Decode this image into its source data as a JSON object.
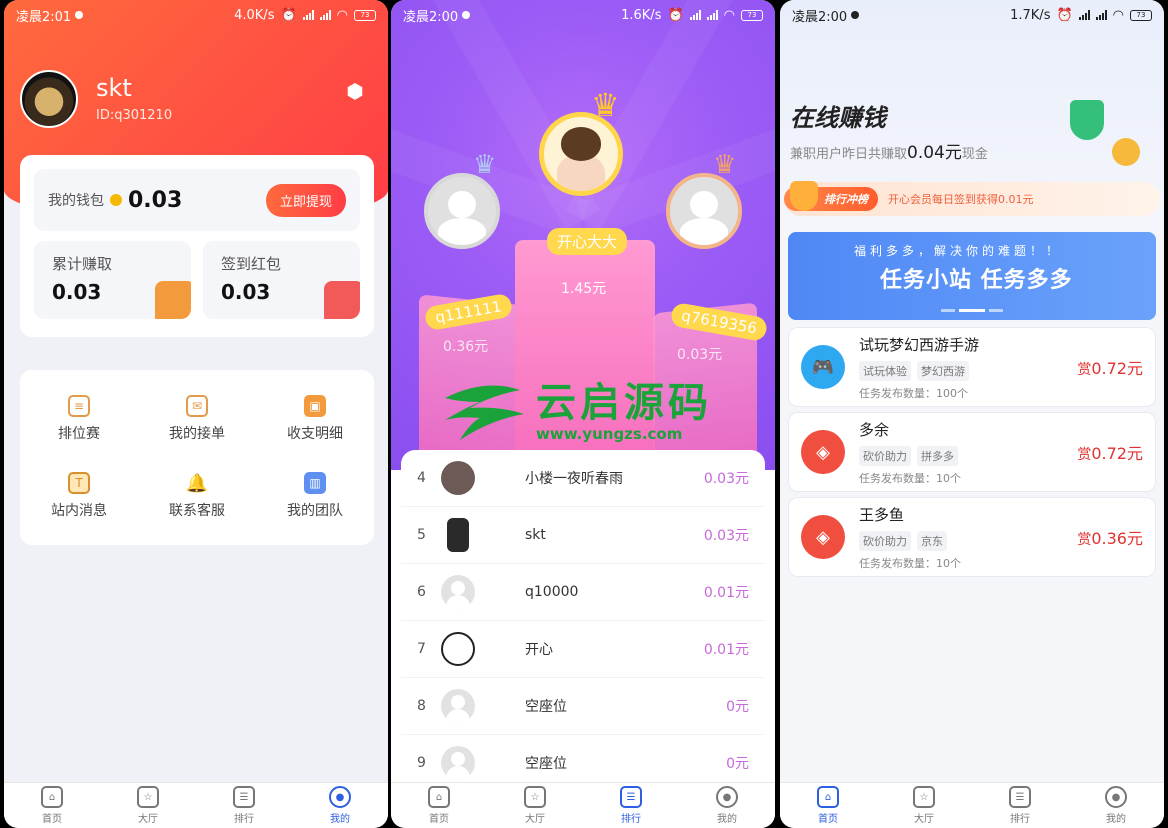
{
  "colors": {
    "accent_red": "#ff4b3e",
    "accent_blue": "#2d5fe0",
    "accent_purple": "#9c5cf6",
    "watermark_green": "#1aa33a"
  },
  "screen1": {
    "status": {
      "time": "凌晨2:01",
      "speed": "4.0K/s",
      "battery": "73"
    },
    "profile": {
      "name": "skt",
      "id": "ID:q301210"
    },
    "wallet": {
      "label": "我的钱包",
      "value": "0.03",
      "button": "立即提现"
    },
    "stats": [
      {
        "label": "累计赚取",
        "value": "0.03"
      },
      {
        "label": "签到红包",
        "value": "0.03"
      }
    ],
    "menu": [
      {
        "label": "排位赛",
        "icon": "rank-doc-icon"
      },
      {
        "label": "我的接单",
        "icon": "mail-icon"
      },
      {
        "label": "收支明细",
        "icon": "wallet-icon"
      },
      {
        "label": "站内消息",
        "icon": "text-icon"
      },
      {
        "label": "联系客服",
        "icon": "bell-icon"
      },
      {
        "label": "我的团队",
        "icon": "chart-icon"
      }
    ],
    "nav": [
      {
        "label": "首页"
      },
      {
        "label": "大厅"
      },
      {
        "label": "排行"
      },
      {
        "label": "我的"
      }
    ]
  },
  "screen2": {
    "status": {
      "time": "凌晨2:00",
      "speed": "1.6K/s",
      "battery": "73"
    },
    "podium": {
      "first": {
        "name": "开心大大",
        "value": "1.45元"
      },
      "second": {
        "name": "q111111",
        "value": "0.36元"
      },
      "third": {
        "name": "q7619356",
        "value": "0.03元"
      }
    },
    "list": [
      {
        "rank": "4",
        "name": "小楼一夜听春雨",
        "value": "0.03元"
      },
      {
        "rank": "5",
        "name": "skt",
        "value": "0.03元"
      },
      {
        "rank": "6",
        "name": "q10000",
        "value": "0.01元"
      },
      {
        "rank": "7",
        "name": "开心",
        "value": "0.01元"
      },
      {
        "rank": "8",
        "name": "空座位",
        "value": "0元"
      },
      {
        "rank": "9",
        "name": "空座位",
        "value": "0元"
      }
    ],
    "watermark": {
      "text": "云启源码",
      "url": "www.yungzs.com"
    },
    "nav": [
      {
        "label": "首页"
      },
      {
        "label": "大厅"
      },
      {
        "label": "排行"
      },
      {
        "label": "我的"
      }
    ]
  },
  "screen3": {
    "status": {
      "time": "凌晨2:00",
      "speed": "1.7K/s",
      "battery": "73"
    },
    "title": "在线赚钱",
    "subtitle_prefix": "兼职用户昨日共赚取",
    "subtitle_amount": "0.04元",
    "subtitle_suffix": "现金",
    "rank_tag": "排行冲榜",
    "rank_text": "开心会员每日签到获得0.01元",
    "banner": {
      "line1": "福利多多，解决你的难题！！",
      "line2": "任务小站  任务多多"
    },
    "tasks": [
      {
        "name": "试玩梦幻西游手游",
        "tags": [
          "试玩体验",
          "梦幻西游"
        ],
        "count": "任务发布数量：100个",
        "reward_prefix": "赏",
        "reward": "0.72元",
        "icon": "gamepad-icon"
      },
      {
        "name": "多余",
        "tags": [
          "砍价助力",
          "拼多多"
        ],
        "count": "任务发布数量：10个",
        "reward_prefix": "赏",
        "reward": "0.72元",
        "icon": "tag-icon"
      },
      {
        "name": "王多鱼",
        "tags": [
          "砍价助力",
          "京东"
        ],
        "count": "任务发布数量：10个",
        "reward_prefix": "赏",
        "reward": "0.36元",
        "icon": "tag-icon"
      }
    ],
    "nav": [
      {
        "label": "首页"
      },
      {
        "label": "大厅"
      },
      {
        "label": "排行"
      },
      {
        "label": "我的"
      }
    ]
  }
}
